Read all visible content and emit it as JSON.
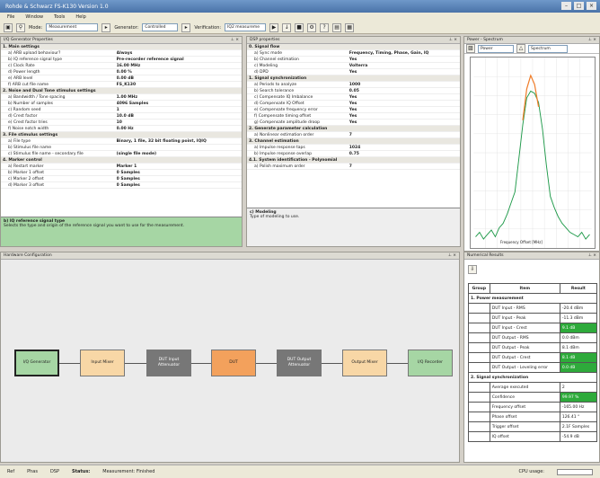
{
  "window": {
    "title": "Rohde & Schwarz FS-K130 Version 1.0"
  },
  "menu": [
    "File",
    "Window",
    "Tools",
    "Help"
  ],
  "toolbar": {
    "mode_label": "Mode:",
    "mode_value": "Measurement",
    "generator_label": "Generator:",
    "generator_value": "Controlled",
    "verification_label": "Verification:",
    "verification_value": "IQ2 measureme"
  },
  "iq_props": {
    "title": "I/Q Generator Properties",
    "rows": [
      {
        "cat": true,
        "name": "1. Main settings"
      },
      {
        "name": "a) ARB upload behaviour?",
        "value": "Always"
      },
      {
        "name": "b) IQ reference signal type",
        "value": "Pre-recorder reference signal"
      },
      {
        "name": "c) Clock Rate",
        "value": "16.00 MHz"
      },
      {
        "name": "d) Power length",
        "value": "0.00 %"
      },
      {
        "name": "e) ARB level",
        "value": "0.00 dB"
      },
      {
        "name": "f) ARB cut file name",
        "value": "FS_K130"
      },
      {
        "cat": true,
        "name": "2. Noise and Dual Tone stimulus settings"
      },
      {
        "name": "a) Bandwidth / Tone spacing",
        "value": "1.00 MHz"
      },
      {
        "name": "b) Number of samples",
        "value": "4096 Samples"
      },
      {
        "name": "c) Random seed",
        "value": "1"
      },
      {
        "name": "d) Crest factor",
        "value": "10.0 dB"
      },
      {
        "name": "e) Crest factor tries",
        "value": "10"
      },
      {
        "name": "f) Noise notch width",
        "value": "0.00 Hz"
      },
      {
        "cat": true,
        "name": "3. File stimulus settings"
      },
      {
        "name": "a) File type",
        "value": "Binary, 1 file, 32 bit floating point, IQIQ"
      },
      {
        "name": "b) Stimulus file name",
        "value": ""
      },
      {
        "name": "c) Stimulus file name - secondary file",
        "value": "(single file mode)"
      },
      {
        "cat": true,
        "name": "4. Marker control"
      },
      {
        "name": "a) Restart marker",
        "value": "Marker 1"
      },
      {
        "name": "b) Marker 1 offset",
        "value": "0 Samples"
      },
      {
        "name": "c) Marker 2 offset",
        "value": "0 Samples"
      },
      {
        "name": "d) Marker 3 offset",
        "value": "0 Samples"
      }
    ],
    "desc_title": "b) IQ reference signal type",
    "desc_text": "Selects the type and origin of the reference signal you want to use for the measurement."
  },
  "dsp_props": {
    "title": "DSP properties",
    "rows": [
      {
        "cat": true,
        "name": "0. Signal flow"
      },
      {
        "name": "a) Sync mode",
        "value": "Frequency, Timing, Phase, Gain, IQ"
      },
      {
        "name": "b) Channel estimation",
        "value": "Yes"
      },
      {
        "name": "c) Modeling",
        "value": "Volterra"
      },
      {
        "name": "d) DPD",
        "value": "Yes"
      },
      {
        "cat": true,
        "name": "1. Signal synchronization"
      },
      {
        "name": "a) Periods to analyze",
        "value": "1000"
      },
      {
        "name": "b) Search tolerance",
        "value": "0.05"
      },
      {
        "name": "c) Compensate IQ Imbalance",
        "value": "Yes"
      },
      {
        "name": "d) Compensate IQ Offset",
        "value": "Yes"
      },
      {
        "name": "e) Compensate frequency error",
        "value": "Yes"
      },
      {
        "name": "f) Compensate timing offset",
        "value": "Yes"
      },
      {
        "name": "g) Compensate amplitude droop",
        "value": "Yes"
      },
      {
        "cat": true,
        "name": "2. Generate parameter calculation"
      },
      {
        "name": "a) Nonlinear estimation order",
        "value": "7"
      },
      {
        "cat": true,
        "name": "3. Channel estimation"
      },
      {
        "name": "a) Impulse response taps",
        "value": "1024"
      },
      {
        "name": "b) Impulse response overlap",
        "value": "0.75"
      },
      {
        "cat": true,
        "name": "4.1. System identification - Polynomial"
      },
      {
        "name": "a) Polish maximum order",
        "value": "7"
      }
    ],
    "desc_title": "c) Modeling",
    "desc_text": "Type of modeling to use."
  },
  "spectrum": {
    "title": "Power - Spectrum",
    "view_label": "Power",
    "type_label": "Spectrum",
    "xlabel": "Frequency Offset [MHz]"
  },
  "chart_data": {
    "type": "line",
    "title": "Power - Spectrum",
    "xlabel": "Frequency Offset [MHz]",
    "series": [
      {
        "values": [
          -70,
          -68,
          -71,
          -69,
          -67,
          -70,
          -66,
          -64,
          -60,
          -55,
          -50,
          -35,
          -20,
          -8,
          -5,
          -6,
          -10,
          -22,
          -38,
          -52,
          -57,
          -61,
          -64,
          -66,
          -68,
          -69,
          -70,
          -68,
          -71,
          -69
        ]
      },
      {
        "values": [
          null,
          null,
          null,
          null,
          null,
          null,
          null,
          null,
          null,
          null,
          null,
          null,
          -18,
          -4,
          2,
          -2,
          -12,
          null,
          null,
          null,
          null,
          null,
          null,
          null,
          null,
          null,
          null,
          null,
          null,
          null
        ]
      }
    ],
    "grid": true
  },
  "hardware": {
    "title": "Hardware Configuration",
    "blocks": [
      {
        "label": "I/Q Generator",
        "color": "#a6d6a4"
      },
      {
        "label": "Input Mixer",
        "color": "#f8d7a6"
      },
      {
        "label": "DUT Input Attenuator",
        "color": "#777777"
      },
      {
        "label": "DUT",
        "color": "#f3a15c"
      },
      {
        "label": "DUT Output Attenuator",
        "color": "#777777"
      },
      {
        "label": "Output Mixer",
        "color": "#f8d7a6"
      },
      {
        "label": "I/Q Recorder",
        "color": "#a6d6a4"
      }
    ]
  },
  "results": {
    "title": "Numerical Results",
    "headers": [
      "Group",
      "Item",
      "Result"
    ],
    "sections": [
      {
        "name": "1. Power measurement",
        "rows": [
          {
            "item": "DUT Input - RMS",
            "result": "-20.4 dBm",
            "ok": false
          },
          {
            "item": "DUT Input - Peak",
            "result": "-11.3 dBm",
            "ok": false
          },
          {
            "item": "DUT Input - Crest",
            "result": "9.1 dB",
            "ok": true
          },
          {
            "item": "DUT Output - RMS",
            "result": "0.0 dBm",
            "ok": false
          },
          {
            "item": "DUT Output - Peak",
            "result": "8.1 dBm",
            "ok": false
          },
          {
            "item": "DUT Output - Crest",
            "result": "8.1 dB",
            "ok": true
          },
          {
            "item": "DUT Output - Leveling error",
            "result": "0.0 dB",
            "ok": true
          }
        ]
      },
      {
        "name": "2. Signal synchronization",
        "rows": [
          {
            "item": "Average executed",
            "result": "2",
            "ok": false
          },
          {
            "item": "Confidence",
            "result": "99.97 %",
            "ok": true
          },
          {
            "item": "Frequency offset",
            "result": "-165.00 Hz",
            "ok": false
          },
          {
            "item": "Phase offset",
            "result": "126.41 °",
            "ok": false
          },
          {
            "item": "Trigger offset",
            "result": "2.1F Samples",
            "ok": false
          },
          {
            "item": "IQ offset",
            "result": "-54.9 dB",
            "ok": false
          }
        ]
      }
    ]
  },
  "status": {
    "ref": "Ref",
    "phas": "Phas",
    "dsp": "DSP",
    "status_label": "Status:",
    "status_value": "Measurement: Finished",
    "cpu": "CPU usage:"
  }
}
